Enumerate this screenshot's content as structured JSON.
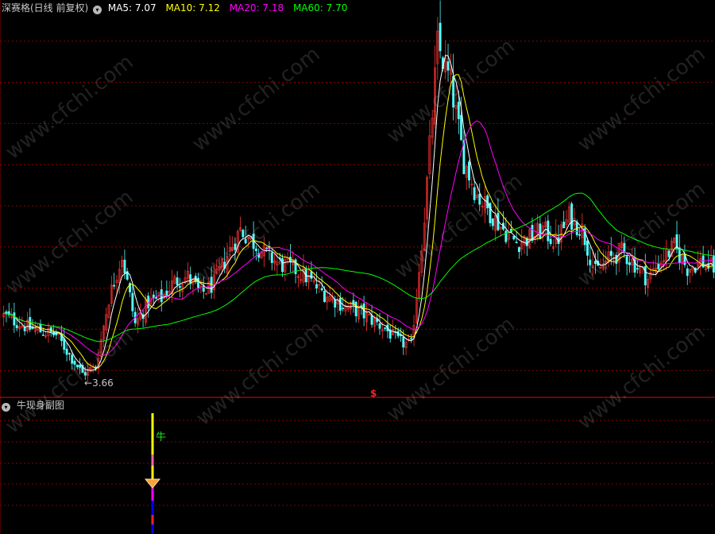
{
  "main_panel": {
    "title": "深赛格(日线 前复权)",
    "indicators": [
      {
        "label": "MA5: 7.07",
        "color": "#ffffff"
      },
      {
        "label": "MA10: 7.12",
        "color": "#ffff00"
      },
      {
        "label": "MA20: 7.18",
        "color": "#ff00ff"
      },
      {
        "label": "MA60: 7.70",
        "color": "#00ff00"
      }
    ],
    "low_label": "3.66",
    "marker_label": "$"
  },
  "sub_panel": {
    "title": "牛现身副图",
    "signal_label": "牛"
  },
  "watermark_text": "www.cfchi.com",
  "colors": {
    "background": "#000000",
    "grid": "#8b0000",
    "up": "#ff3232",
    "down": "#54ffff",
    "ma5": "#ffffff",
    "ma10": "#ffff00",
    "ma20": "#ff00ff",
    "ma60": "#00ff00"
  },
  "chart_data": [
    {
      "type": "candlestick",
      "title": "深赛格(日线 前复权)",
      "series": [
        {
          "name": "MA5",
          "last": 7.07
        },
        {
          "name": "MA10",
          "last": 7.12
        },
        {
          "name": "MA20",
          "last": 7.18
        },
        {
          "name": "MA60",
          "last": 7.7
        }
      ],
      "annotations": [
        {
          "text": "3.66",
          "meaning": "period low"
        }
      ],
      "grid": true,
      "close_trend": [
        [
          0,
          5.2
        ],
        [
          10,
          4.9
        ],
        [
          20,
          4.75
        ],
        [
          25,
          4.3
        ],
        [
          30,
          3.85
        ],
        [
          35,
          4.0
        ],
        [
          40,
          5.6
        ],
        [
          45,
          6.6
        ],
        [
          50,
          5.0
        ],
        [
          55,
          5.5
        ],
        [
          60,
          5.6
        ],
        [
          65,
          6.0
        ],
        [
          70,
          6.1
        ],
        [
          75,
          5.7
        ],
        [
          80,
          5.95
        ],
        [
          85,
          6.6
        ],
        [
          90,
          7.2
        ],
        [
          95,
          6.9
        ],
        [
          100,
          6.6
        ],
        [
          105,
          6.4
        ],
        [
          110,
          6.3
        ],
        [
          115,
          6.1
        ],
        [
          120,
          5.8
        ],
        [
          125,
          5.6
        ],
        [
          130,
          5.4
        ],
        [
          135,
          5.3
        ],
        [
          140,
          5.1
        ],
        [
          145,
          4.9
        ],
        [
          150,
          4.6
        ],
        [
          155,
          4.5
        ],
        [
          160,
          7.5
        ],
        [
          165,
          11.5
        ],
        [
          170,
          10.6
        ],
        [
          175,
          8.8
        ],
        [
          180,
          8.0
        ],
        [
          185,
          7.6
        ],
        [
          190,
          7.2
        ],
        [
          195,
          6.9
        ],
        [
          200,
          7.0
        ],
        [
          205,
          7.2
        ],
        [
          210,
          6.9
        ],
        [
          215,
          7.5
        ],
        [
          220,
          7.2
        ],
        [
          225,
          6.2
        ],
        [
          230,
          6.5
        ],
        [
          235,
          6.7
        ],
        [
          240,
          6.4
        ],
        [
          245,
          6.05
        ],
        [
          250,
          6.5
        ],
        [
          255,
          6.8
        ],
        [
          260,
          6.3
        ],
        [
          265,
          6.45
        ],
        [
          270,
          6.3
        ]
      ]
    },
    {
      "type": "bar",
      "title": "牛现身副图",
      "annotations": [
        {
          "text": "牛",
          "meaning": "signal"
        }
      ]
    }
  ]
}
